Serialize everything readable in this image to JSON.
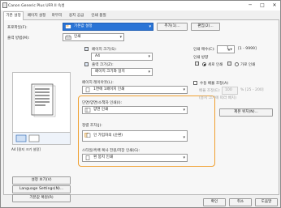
{
  "window": {
    "title": "Canon Generic Plus UFR II 속성",
    "minimize_glyph": "─",
    "maximize_glyph": "□",
    "close_glyph": "✕"
  },
  "tabs": [
    {
      "label": "기본 설정"
    },
    {
      "label": "페이지 설정"
    },
    {
      "label": "마무리"
    },
    {
      "label": "용지 공급"
    },
    {
      "label": "인쇄 품질"
    }
  ],
  "profile": {
    "label": "프로파일(F):",
    "value": "기본값 설정",
    "add_button": "추가(1)...",
    "edit_button": "편집(2)..."
  },
  "output_method": {
    "label": "출력 방법(M):",
    "value": "인쇄"
  },
  "page_size": {
    "label": "페이지 크기(S):",
    "value": "A4"
  },
  "output_size": {
    "label": "출력 크기(Z):",
    "value": "페이지 크기와 일치"
  },
  "copies": {
    "label": "인쇄 매수(C):",
    "value": "1",
    "range": "[1 - 9999]"
  },
  "orientation": {
    "label": "인쇄 방향",
    "portrait": "세로 인쇄",
    "landscape": "가로 인쇄",
    "selected": "portrait"
  },
  "page_layout": {
    "label": "페이지 레이아웃(L):",
    "value": "1면에 1페이지 인쇄"
  },
  "manual_scaling": {
    "label": "수동 배율 조정(A)",
    "checked": false,
    "scale_label": "배율 조정(E):",
    "scale_value": "100",
    "scale_range": "% [25 - 200]",
    "note": "(용지 크기에 따라 배치)"
  },
  "duplex": {
    "label": "단면/양면/소책자 인쇄(I):",
    "value": "양면 인쇄"
  },
  "binding_button": "제본 위치(N)...",
  "collate": {
    "label": "정렬 조치(J):",
    "value": "인 가입자의 (순환)"
  },
  "color_mode": {
    "label": "스타일/흑백 복사 전원/저장 인쇄(G):",
    "value": "흰 봉지 인쇄"
  },
  "left_panel": {
    "settings_tab": "A4 [용지 크기 설정]",
    "status_buttons": [
      "설정 보기(V)",
      "Language Settings(N)...",
      "기본값 복원(R)"
    ]
  },
  "dialog_buttons": {
    "ok": "확인",
    "cancel": "취소",
    "help": "도움말"
  }
}
